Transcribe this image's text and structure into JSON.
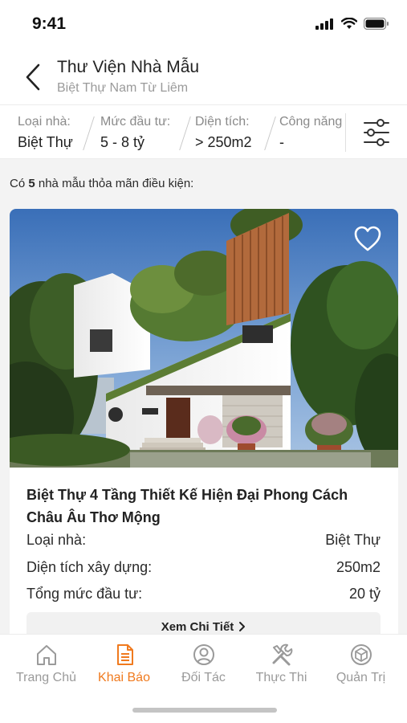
{
  "status_bar": {
    "time": "9:41"
  },
  "header": {
    "title": "Thư Viện Nhà Mẫu",
    "subtitle": "Biệt Thự Nam Từ Liêm"
  },
  "filters": [
    {
      "label": "Loại nhà:",
      "value": "Biệt Thự"
    },
    {
      "label": "Mức đầu tư:",
      "value": "5 - 8 tỷ"
    },
    {
      "label": "Diện tích:",
      "value": "> 250m2"
    },
    {
      "label": "Công năng:",
      "value": "-"
    }
  ],
  "results": {
    "prefix": "Có",
    "count": "5",
    "suffix": "nhà mẫu thỏa mãn điều kiện:"
  },
  "card": {
    "title": "Biệt Thự 4 Tầng Thiết Kế Hiện Đại Phong Cách Châu Âu Thơ Mộng",
    "rows": [
      {
        "label": "Loại nhà:",
        "value": "Biệt Thự"
      },
      {
        "label": "Diện tích xây dựng:",
        "value": "250m2"
      },
      {
        "label": "Tổng mức đầu tư:",
        "value": "20 tỷ"
      }
    ],
    "detail_button": "Xem Chi Tiết",
    "favorite_icon": "heart-outline-icon"
  },
  "bottom_nav": [
    {
      "label": "Trang Chủ",
      "icon": "home-icon",
      "active": false
    },
    {
      "label": "Khai Báo",
      "icon": "document-icon",
      "active": true
    },
    {
      "label": "Đối Tác",
      "icon": "user-circle-icon",
      "active": false
    },
    {
      "label": "Thực Thi",
      "icon": "tools-icon",
      "active": false
    },
    {
      "label": "Quản Trị",
      "icon": "cube-icon",
      "active": false
    }
  ],
  "colors": {
    "accent": "#f07a1e",
    "muted": "#9a9a9a",
    "background_gray": "#f3f3f3"
  }
}
